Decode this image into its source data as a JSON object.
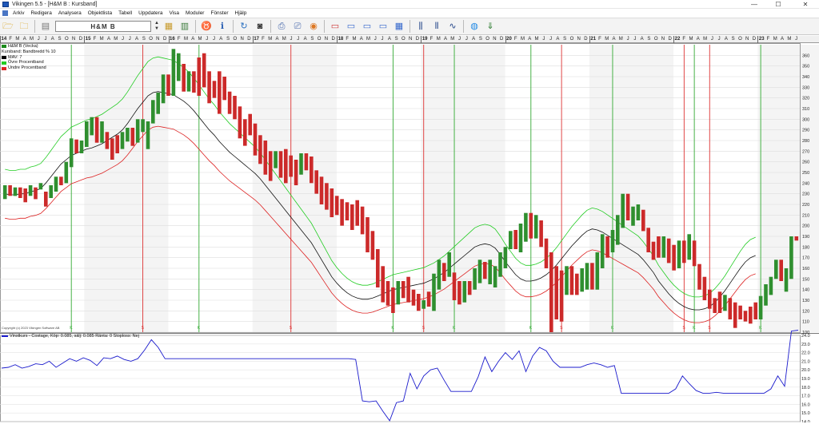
{
  "window": {
    "title": "Vikingen 5.5 - [H&M B : Kursband]",
    "minimize": "—",
    "maximize": "☐",
    "close": "✕"
  },
  "menu": [
    "Arkiv",
    "Redigera",
    "Analysera",
    "Objektlista",
    "Tabell",
    "Uppdatera",
    "Visa",
    "Moduler",
    "Fönster",
    "Hjälp"
  ],
  "toolbar": {
    "instrument": "H&M B"
  },
  "legend": [
    {
      "label": "H&M B (Vecka)",
      "color": "#1b8a1b"
    },
    {
      "label": "Kursband: Bandbredd % 10",
      "color": ""
    },
    {
      "label": "MAV: 7",
      "color": "#000000"
    },
    {
      "label": "Övre Procentband",
      "color": "#22cc22"
    },
    {
      "label": "Undre Procentband",
      "color": "#dd2222"
    }
  ],
  "copyright": "Copyright (c) 2023 Vikingen Software AB",
  "indicator_label": "Vinstkurs - Costage, Köp: 0.085, sälj: 0.085 Ränta: 0 Stoploss: Nej",
  "timeline": {
    "months": [
      "J",
      "F",
      "M",
      "A",
      "M",
      "J",
      "J",
      "A",
      "S",
      "O",
      "N",
      "D"
    ],
    "years": [
      "14",
      "15",
      "16",
      "17",
      "18",
      "19",
      "20",
      "21",
      "22",
      "23"
    ]
  },
  "chart_data": [
    {
      "type": "candlestick",
      "title": "H&M B (Vecka)",
      "ylim": [
        100,
        370
      ],
      "yticks": [
        100,
        110,
        120,
        130,
        140,
        150,
        160,
        170,
        180,
        190,
        200,
        210,
        220,
        230,
        240,
        250,
        260,
        270,
        280,
        290,
        300,
        310,
        320,
        330,
        340,
        350,
        360
      ],
      "bars": [
        {
          "d": "u",
          "o": 225,
          "c": 238
        },
        {
          "d": "d",
          "o": 238,
          "c": 228
        },
        {
          "d": "u",
          "o": 228,
          "c": 236
        },
        {
          "d": "d",
          "o": 236,
          "c": 226
        },
        {
          "d": "d",
          "o": 235,
          "c": 222
        },
        {
          "d": "u",
          "o": 228,
          "c": 238
        },
        {
          "d": "d",
          "o": 236,
          "c": 225
        },
        {
          "d": "u",
          "o": 234,
          "c": 240
        },
        {
          "d": "d",
          "o": 232,
          "c": 218
        },
        {
          "d": "u",
          "o": 226,
          "c": 238
        },
        {
          "d": "u",
          "o": 232,
          "c": 246
        },
        {
          "d": "d",
          "o": 246,
          "c": 238
        },
        {
          "d": "u",
          "o": 240,
          "c": 260
        },
        {
          "d": "u",
          "o": 255,
          "c": 282
        },
        {
          "d": "d",
          "o": 281,
          "c": 268
        },
        {
          "d": "u",
          "o": 268,
          "c": 280
        },
        {
          "d": "u",
          "o": 274,
          "c": 298
        },
        {
          "d": "u",
          "o": 285,
          "c": 302
        },
        {
          "d": "d",
          "o": 302,
          "c": 278
        },
        {
          "d": "u",
          "o": 278,
          "c": 298
        },
        {
          "d": "d",
          "o": 288,
          "c": 272
        },
        {
          "d": "d",
          "o": 282,
          "c": 262
        },
        {
          "d": "d",
          "o": 285,
          "c": 268
        },
        {
          "d": "u",
          "o": 272,
          "c": 288
        },
        {
          "d": "u",
          "o": 279,
          "c": 292
        },
        {
          "d": "d",
          "o": 292,
          "c": 275
        },
        {
          "d": "u",
          "o": 278,
          "c": 300
        },
        {
          "d": "u",
          "o": 288,
          "c": 300
        },
        {
          "d": "u",
          "o": 272,
          "c": 298
        },
        {
          "d": "u",
          "o": 296,
          "c": 318
        },
        {
          "d": "u",
          "o": 305,
          "c": 325
        },
        {
          "d": "u",
          "o": 315,
          "c": 342
        },
        {
          "d": "d",
          "o": 342,
          "c": 322
        },
        {
          "d": "u",
          "o": 322,
          "c": 366
        },
        {
          "d": "u",
          "o": 336,
          "c": 362
        },
        {
          "d": "d",
          "o": 352,
          "c": 326
        },
        {
          "d": "u",
          "o": 326,
          "c": 345
        },
        {
          "d": "d",
          "o": 345,
          "c": 325
        },
        {
          "d": "d",
          "o": 358,
          "c": 322
        },
        {
          "d": "d",
          "o": 362,
          "c": 330
        },
        {
          "d": "d",
          "o": 345,
          "c": 315
        },
        {
          "d": "d",
          "o": 336,
          "c": 320
        },
        {
          "d": "d",
          "o": 345,
          "c": 305
        },
        {
          "d": "d",
          "o": 340,
          "c": 318
        },
        {
          "d": "d",
          "o": 326,
          "c": 305
        },
        {
          "d": "d",
          "o": 322,
          "c": 300
        },
        {
          "d": "d",
          "o": 312,
          "c": 282
        },
        {
          "d": "d",
          "o": 300,
          "c": 275
        },
        {
          "d": "d",
          "o": 305,
          "c": 285
        },
        {
          "d": "d",
          "o": 296,
          "c": 266
        },
        {
          "d": "d",
          "o": 285,
          "c": 258
        },
        {
          "d": "d",
          "o": 280,
          "c": 248
        },
        {
          "d": "d",
          "o": 270,
          "c": 242
        },
        {
          "d": "u",
          "o": 254,
          "c": 270
        },
        {
          "d": "d",
          "o": 270,
          "c": 245
        },
        {
          "d": "d",
          "o": 272,
          "c": 240
        },
        {
          "d": "d",
          "o": 266,
          "c": 246
        },
        {
          "d": "d",
          "o": 262,
          "c": 238
        },
        {
          "d": "u",
          "o": 248,
          "c": 268
        },
        {
          "d": "d",
          "o": 268,
          "c": 252
        },
        {
          "d": "d",
          "o": 265,
          "c": 240
        },
        {
          "d": "d",
          "o": 252,
          "c": 230
        },
        {
          "d": "d",
          "o": 246,
          "c": 220
        },
        {
          "d": "d",
          "o": 240,
          "c": 215
        },
        {
          "d": "d",
          "o": 235,
          "c": 208
        },
        {
          "d": "d",
          "o": 228,
          "c": 210
        },
        {
          "d": "d",
          "o": 225,
          "c": 200
        },
        {
          "d": "d",
          "o": 222,
          "c": 205
        },
        {
          "d": "d",
          "o": 220,
          "c": 196
        },
        {
          "d": "d",
          "o": 224,
          "c": 200
        },
        {
          "d": "d",
          "o": 218,
          "c": 192
        },
        {
          "d": "d",
          "o": 208,
          "c": 175
        },
        {
          "d": "d",
          "o": 195,
          "c": 168
        },
        {
          "d": "d",
          "o": 178,
          "c": 142
        },
        {
          "d": "d",
          "o": 162,
          "c": 128
        },
        {
          "d": "d",
          "o": 148,
          "c": 125
        },
        {
          "d": "d",
          "o": 142,
          "c": 118
        },
        {
          "d": "u",
          "o": 126,
          "c": 148
        },
        {
          "d": "d",
          "o": 148,
          "c": 132
        },
        {
          "d": "d",
          "o": 152,
          "c": 128
        },
        {
          "d": "d",
          "o": 140,
          "c": 125
        },
        {
          "d": "d",
          "o": 136,
          "c": 120
        },
        {
          "d": "u",
          "o": 122,
          "c": 130
        },
        {
          "d": "d",
          "o": 138,
          "c": 124
        },
        {
          "d": "u",
          "o": 120,
          "c": 155
        },
        {
          "d": "u",
          "o": 140,
          "c": 168
        },
        {
          "d": "d",
          "o": 165,
          "c": 148
        },
        {
          "d": "u",
          "o": 152,
          "c": 175
        },
        {
          "d": "d",
          "o": 156,
          "c": 130
        },
        {
          "d": "d",
          "o": 148,
          "c": 126
        },
        {
          "d": "u",
          "o": 128,
          "c": 148
        },
        {
          "d": "d",
          "o": 148,
          "c": 135
        },
        {
          "d": "u",
          "o": 140,
          "c": 160
        },
        {
          "d": "u",
          "o": 146,
          "c": 168
        },
        {
          "d": "d",
          "o": 166,
          "c": 150
        },
        {
          "d": "u",
          "o": 145,
          "c": 168
        },
        {
          "d": "u",
          "o": 142,
          "c": 162
        },
        {
          "d": "u",
          "o": 152,
          "c": 175
        },
        {
          "d": "u",
          "o": 160,
          "c": 180
        },
        {
          "d": "u",
          "o": 178,
          "c": 195
        },
        {
          "d": "d",
          "o": 196,
          "c": 178
        },
        {
          "d": "u",
          "o": 175,
          "c": 202
        },
        {
          "d": "u",
          "o": 185,
          "c": 212
        },
        {
          "d": "d",
          "o": 212,
          "c": 188
        },
        {
          "d": "u",
          "o": 188,
          "c": 210
        },
        {
          "d": "d",
          "o": 205,
          "c": 180
        },
        {
          "d": "d",
          "o": 188,
          "c": 160
        },
        {
          "d": "d",
          "o": 175,
          "c": 100
        },
        {
          "d": "d",
          "o": 162,
          "c": 112
        },
        {
          "d": "d",
          "o": 158,
          "c": 110
        },
        {
          "d": "u",
          "o": 135,
          "c": 162
        },
        {
          "d": "d",
          "o": 162,
          "c": 135
        },
        {
          "d": "d",
          "o": 155,
          "c": 135
        },
        {
          "d": "u",
          "o": 138,
          "c": 160
        },
        {
          "d": "u",
          "o": 140,
          "c": 165
        },
        {
          "d": "d",
          "o": 165,
          "c": 140
        },
        {
          "d": "u",
          "o": 140,
          "c": 175
        },
        {
          "d": "u",
          "o": 160,
          "c": 192
        },
        {
          "d": "d",
          "o": 190,
          "c": 170
        },
        {
          "d": "u",
          "o": 175,
          "c": 196
        },
        {
          "d": "u",
          "o": 182,
          "c": 210
        },
        {
          "d": "u",
          "o": 198,
          "c": 230
        },
        {
          "d": "d",
          "o": 230,
          "c": 205
        },
        {
          "d": "u",
          "o": 200,
          "c": 218
        },
        {
          "d": "u",
          "o": 205,
          "c": 220
        },
        {
          "d": "d",
          "o": 215,
          "c": 195
        },
        {
          "d": "d",
          "o": 198,
          "c": 175
        },
        {
          "d": "d",
          "o": 185,
          "c": 168
        },
        {
          "d": "d",
          "o": 190,
          "c": 170
        },
        {
          "d": "u",
          "o": 170,
          "c": 190
        },
        {
          "d": "d",
          "o": 188,
          "c": 165
        },
        {
          "d": "d",
          "o": 182,
          "c": 158
        },
        {
          "d": "u",
          "o": 160,
          "c": 186
        },
        {
          "d": "d",
          "o": 186,
          "c": 165
        },
        {
          "d": "u",
          "o": 168,
          "c": 192
        },
        {
          "d": "d",
          "o": 186,
          "c": 162
        },
        {
          "d": "d",
          "o": 164,
          "c": 140
        },
        {
          "d": "d",
          "o": 152,
          "c": 130
        },
        {
          "d": "d",
          "o": 140,
          "c": 122
        },
        {
          "d": "d",
          "o": 132,
          "c": 118
        },
        {
          "d": "d",
          "o": 138,
          "c": 118
        },
        {
          "d": "u",
          "o": 120,
          "c": 135
        },
        {
          "d": "d",
          "o": 132,
          "c": 112
        },
        {
          "d": "d",
          "o": 128,
          "c": 104
        },
        {
          "d": "d",
          "o": 125,
          "c": 112
        },
        {
          "d": "d",
          "o": 120,
          "c": 110
        },
        {
          "d": "d",
          "o": 124,
          "c": 108
        },
        {
          "d": "d",
          "o": 128,
          "c": 112
        },
        {
          "d": "u",
          "o": 112,
          "c": 134
        },
        {
          "d": "u",
          "o": 125,
          "c": 145
        },
        {
          "d": "u",
          "o": 135,
          "c": 152
        },
        {
          "d": "u",
          "o": 150,
          "c": 168
        },
        {
          "d": "d",
          "o": 168,
          "c": 148
        },
        {
          "d": "u",
          "o": 138,
          "c": 160
        },
        {
          "d": "u",
          "o": 150,
          "c": 190
        },
        {
          "d": "d",
          "o": 190,
          "c": 186
        }
      ],
      "mav": [
        230,
        229,
        229,
        230,
        230,
        232,
        233,
        235,
        240,
        246,
        252,
        258,
        262,
        266,
        268,
        270,
        272,
        273,
        275,
        277,
        280,
        283,
        286,
        290,
        296,
        303,
        310,
        316,
        322,
        325,
        326,
        325,
        324,
        323,
        320,
        317,
        313,
        308,
        302,
        296,
        290,
        285,
        279,
        274,
        269,
        265,
        261,
        257,
        253,
        249,
        244,
        238,
        232,
        226,
        220,
        214,
        208,
        202,
        196,
        190,
        184,
        176,
        168,
        160,
        152,
        146,
        141,
        137,
        134,
        132,
        131,
        131,
        132,
        134,
        136,
        138,
        140,
        141,
        142,
        143,
        144,
        145,
        146,
        148,
        150,
        153,
        156,
        160,
        164,
        168,
        172,
        176,
        180,
        182,
        183,
        182,
        179,
        173,
        166,
        160,
        154,
        150,
        148,
        148,
        149,
        151,
        154,
        158,
        163,
        169,
        175,
        181,
        186,
        191,
        195,
        197,
        196,
        194,
        191,
        188,
        185,
        182,
        179,
        176,
        173,
        168,
        162,
        156,
        148,
        142,
        136,
        131,
        127,
        124,
        122,
        121,
        121,
        122,
        124,
        128,
        133,
        139,
        146,
        153,
        160,
        166,
        170,
        172
      ],
      "signals": [
        {
          "label": "K",
          "color": "#33aa33"
        },
        {
          "label": "S",
          "color": "#dd3333"
        },
        {
          "label": "K",
          "color": "#33aa33"
        },
        {
          "label": "S",
          "color": "#dd3333"
        },
        {
          "label": "K",
          "color": "#33aa33"
        },
        {
          "label": "S",
          "color": "#dd3333"
        },
        {
          "label": "K",
          "color": "#33aa33"
        },
        {
          "label": "K",
          "color": "#33aa33"
        },
        {
          "label": "S",
          "color": "#dd3333"
        },
        {
          "label": "K",
          "color": "#33aa33"
        },
        {
          "label": "S",
          "color": "#dd3333"
        },
        {
          "label": "K",
          "color": "#33aa33"
        },
        {
          "label": "S",
          "color": "#dd3333"
        },
        {
          "label": "K",
          "color": "#33aa33"
        }
      ]
    },
    {
      "type": "line",
      "title": "Vinstkurs - Costage",
      "ylim": [
        14.0,
        24.0
      ],
      "yticks": [
        14.0,
        15.0,
        16.0,
        17.0,
        18.0,
        19.0,
        20.0,
        21.0,
        22.0,
        23.0,
        24.0
      ],
      "series": [
        {
          "values": [
            20.2,
            20.3,
            20.6,
            20.2,
            20.4,
            20.7,
            20.6,
            21.0,
            20.3,
            20.8,
            21.3,
            21.0,
            21.4,
            21.1,
            20.5,
            21.4,
            21.3,
            21.6,
            21.2,
            21.0,
            21.3,
            22.3,
            23.5,
            22.6,
            21.3,
            21.3,
            21.3,
            21.3,
            21.3,
            21.3,
            21.3,
            21.3,
            21.3,
            21.3,
            21.3,
            21.3,
            21.3,
            21.3,
            21.3,
            21.3,
            21.3,
            21.3,
            21.3,
            21.3,
            21.3,
            21.3,
            21.3,
            21.3,
            21.3,
            21.3,
            21.3,
            21.3,
            21.2,
            16.4,
            16.3,
            16.4,
            15.2,
            14.1,
            16.2,
            16.4,
            19.6,
            17.8,
            19.3,
            20.0,
            20.2,
            18.8,
            17.5,
            17.5,
            17.5,
            17.5,
            19.2,
            21.5,
            19.8,
            21.0,
            22.0,
            21.2,
            22.2,
            19.8,
            21.6,
            22.6,
            22.2,
            21.0,
            20.3,
            20.3,
            20.3,
            20.3,
            20.6,
            20.8,
            20.6,
            20.3,
            20.5,
            17.3,
            17.3,
            17.3,
            17.3,
            17.3,
            17.3,
            17.3,
            17.3,
            17.8,
            19.3,
            18.4,
            17.6,
            17.3,
            17.3,
            17.4,
            17.3,
            17.3,
            17.3,
            17.3,
            17.3,
            17.3,
            17.3,
            17.8,
            19.3,
            18.1,
            24.5,
            24.6
          ]
        }
      ]
    }
  ]
}
